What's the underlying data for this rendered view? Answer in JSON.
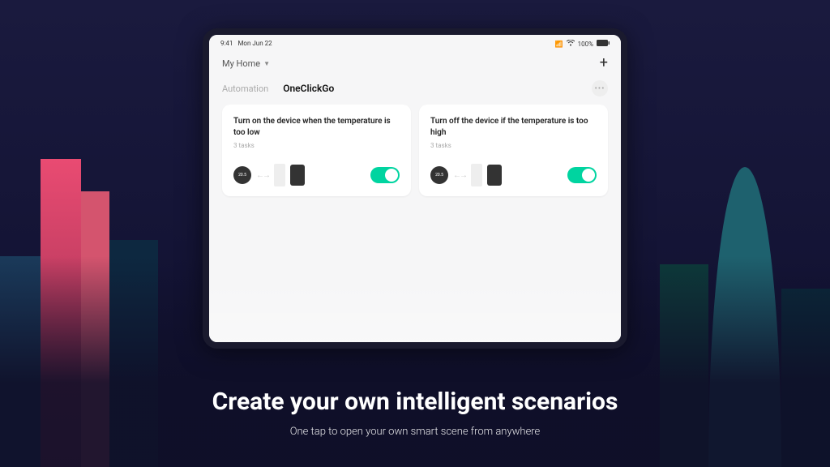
{
  "statusBar": {
    "time": "9:41",
    "date": "Mon Jun 22",
    "battery": "100%"
  },
  "header": {
    "homeLabel": "My Home"
  },
  "tabs": {
    "automation": "Automation",
    "oneclick": "OneClickGo"
  },
  "cards": [
    {
      "title": "Turn on the device when the temperature is too low",
      "subtitle": "3 tasks",
      "sensor": "20.5"
    },
    {
      "title": "Turn off the device if the temperature is too high",
      "subtitle": "3 tasks",
      "sensor": "20.5"
    }
  ],
  "page": {
    "headline": "Create your own intelligent scenarios",
    "subtitle": "One tap to open your own smart scene from anywhere"
  }
}
